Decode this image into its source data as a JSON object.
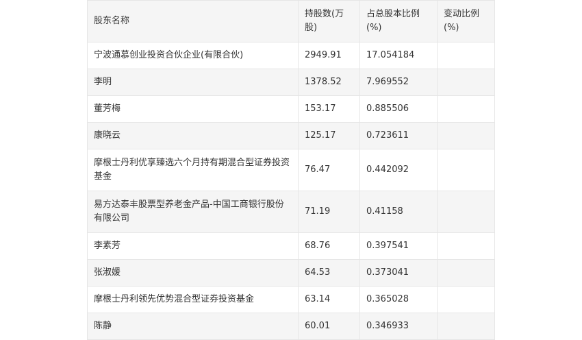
{
  "table": {
    "headers": [
      "股东名称",
      "持股数(万股)",
      "占总股本比例(%)",
      "变动比例(%)"
    ],
    "rows": [
      [
        "宁波通慕创业投资合伙企业(有限合伙)",
        "2949.91",
        "17.054184",
        ""
      ],
      [
        "李明",
        "1378.52",
        "7.969552",
        ""
      ],
      [
        "董芳梅",
        "153.17",
        "0.885506",
        ""
      ],
      [
        "康晓云",
        "125.17",
        "0.723611",
        ""
      ],
      [
        "摩根士丹利优享臻选六个月持有期混合型证券投资基金",
        "76.47",
        "0.442092",
        ""
      ],
      [
        "易方达泰丰股票型养老金产品-中国工商银行股份有限公司",
        "71.19",
        "0.41158",
        ""
      ],
      [
        "李素芳",
        "68.76",
        "0.397541",
        ""
      ],
      [
        "张淑媛",
        "64.53",
        "0.373041",
        ""
      ],
      [
        "摩根士丹利领先优势混合型证券投资基金",
        "63.14",
        "0.365028",
        ""
      ],
      [
        "陈静",
        "60.01",
        "0.346933",
        ""
      ]
    ]
  }
}
